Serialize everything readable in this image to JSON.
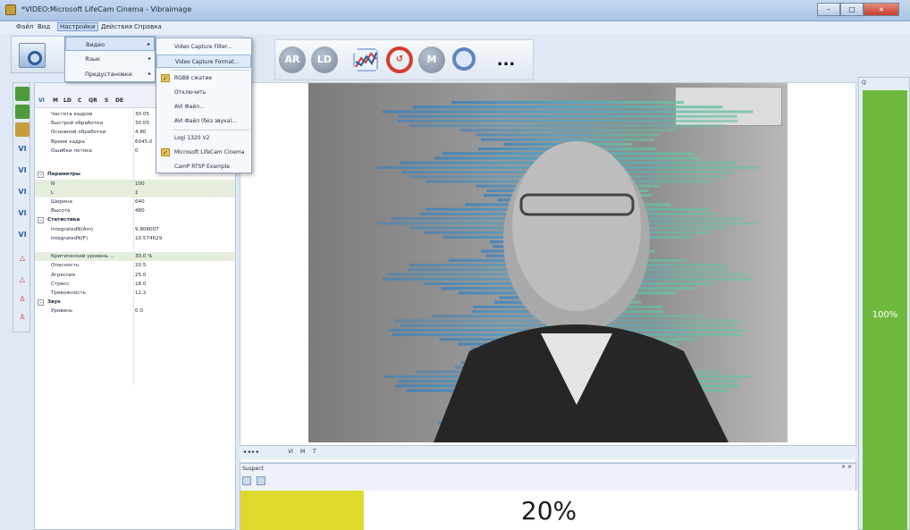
{
  "window": {
    "title": "*VIDEO:Microsoft LifeCam Cinema - Vibraimage",
    "controls": [
      "–",
      "□",
      "×"
    ]
  },
  "menubar": {
    "items": [
      "Файл",
      "Вид",
      "Настройки",
      "Действия",
      "Справка"
    ],
    "active_index": 2
  },
  "settings_menu": {
    "items": [
      {
        "label": "Видео",
        "has_submenu": true
      },
      {
        "label": "Язык",
        "has_submenu": true
      },
      {
        "label": "Предустановки",
        "has_submenu": true
      }
    ],
    "active_index": 0
  },
  "video_submenu": {
    "items": [
      {
        "label": "Video Capture Filter...",
        "checked": false
      },
      {
        "label": "Video Capture Format...",
        "checked": false
      },
      {
        "label": "RGB8 сжатие",
        "checked": true
      },
      {
        "label": "Отключить",
        "checked": false
      },
      {
        "label": "AVI Файл...",
        "checked": false
      },
      {
        "label": "AVI Файл (без звука)...",
        "checked": false
      },
      {
        "label": "Logi 1320 V2",
        "checked": false
      },
      {
        "label": "Microsoft LifeCam Cinema",
        "checked": true
      },
      {
        "label": "CamP RTSP Example",
        "checked": false
      }
    ],
    "active_index": 1
  },
  "toolbar": {
    "buttons": [
      "camera-icon",
      "AR",
      "LD",
      "chart-icon",
      "reset-icon",
      "M",
      "zoom-icon",
      "..."
    ]
  },
  "property_tabs": [
    "VI",
    "M",
    "LD",
    "C",
    "QR",
    "S",
    "DE"
  ],
  "properties": {
    "top_rows": [
      {
        "key": "Частота кадров",
        "value": "30.05"
      },
      {
        "key": "Быстрой обработки",
        "value": "30.05"
      },
      {
        "key": "Основной обработки",
        "value": "4.80"
      },
      {
        "key": "Время кадра",
        "value": "6045.0"
      },
      {
        "key": "Ошибки потока",
        "value": "0"
      }
    ],
    "groups": [
      {
        "title": "Параметры",
        "rows": [
          {
            "key": "N",
            "value": "100",
            "selected": true
          },
          {
            "key": "L",
            "value": "2",
            "selected": true
          },
          {
            "key": "Ширина",
            "value": "640",
            "selected": false
          },
          {
            "key": "Высота",
            "value": "480",
            "selected": false
          }
        ]
      },
      {
        "title": "Статистика",
        "rows": [
          {
            "key": "IntegratedN(Am)",
            "value": "9.808007",
            "selected": false
          },
          {
            "key": "IntegratedN(F)",
            "value": "10.574629",
            "selected": false
          },
          {
            "key": "",
            "value": "",
            "selected": false
          },
          {
            "key": "Критический уровень ...",
            "value": "30.0 %",
            "selected": true
          },
          {
            "key": "Опасность",
            "value": "20.5",
            "selected": false
          },
          {
            "key": "Агрессия",
            "value": "25.0",
            "selected": false
          },
          {
            "key": "Стресс",
            "value": "18.0",
            "selected": false
          },
          {
            "key": "Тревожность",
            "value": "12.2",
            "selected": false
          }
        ]
      },
      {
        "title": "Звук",
        "rows": [
          {
            "key": "Уровень",
            "value": "0.0",
            "selected": false
          }
        ]
      }
    ]
  },
  "video_tabs": {
    "nav": "◂ ◂ ▸ ▸",
    "labels": [
      "VI",
      "M",
      "T"
    ]
  },
  "q_panel": {
    "header": "Q",
    "percent": 100,
    "label": "100%",
    "color": "#6fb93e"
  },
  "suspect_panel": {
    "header": "Suspect",
    "percent": 20,
    "label": "20%",
    "fill_color": "#dfd92c"
  }
}
